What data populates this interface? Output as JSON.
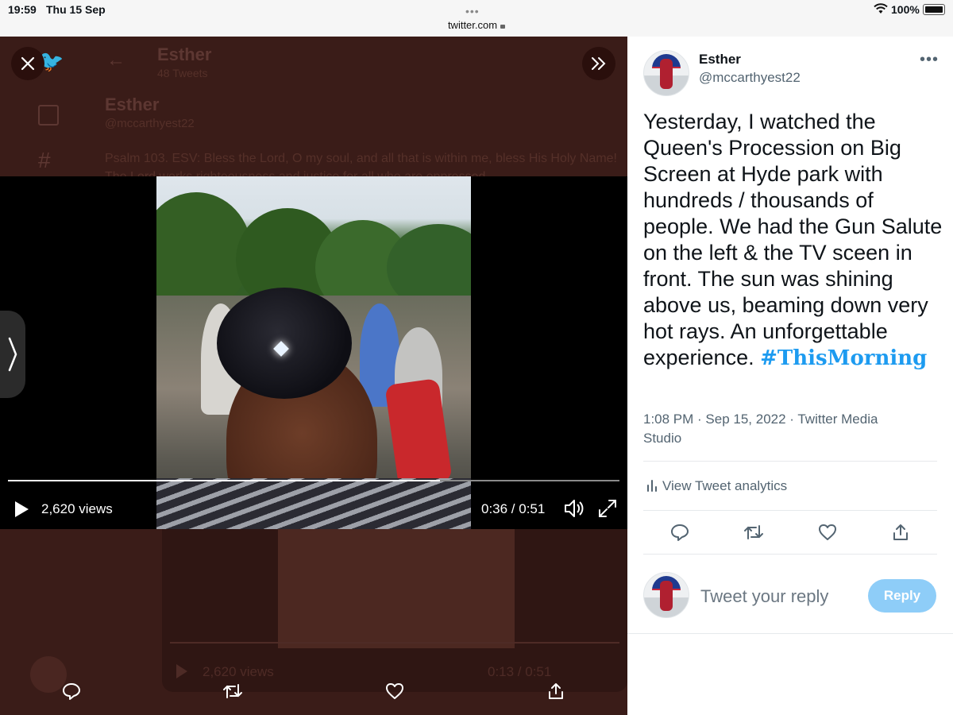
{
  "status_bar": {
    "time": "19:59",
    "date": "Thu 15 Sep",
    "url": "twitter.com",
    "battery": "100%"
  },
  "background": {
    "profile_name": "Esther",
    "tweet_count": "48 Tweets",
    "name": "Esther",
    "handle": "@mccarthyest22",
    "text": "Psalm 103. ESV: Bless the Lord, O my soul, and all that is within me, bless His Holy Name! The Lord works righteousness and justice for all who are oppressed"
  },
  "video": {
    "views": "2,620 views",
    "time": "0:36 / 0:51",
    "progress_fraction": 0.706
  },
  "ghost_video": {
    "views": "2,620 views",
    "time": "0:13 / 0:51"
  },
  "tweet": {
    "name": "Esther",
    "handle": "@mccarthyest22",
    "text": "Yesterday, I watched the Queen's Procession on Big Screen at Hyde park with hundreds / thousands of people. We had the Gun Salute on the left & the TV sceen in front. The sun was shining above us, beaming down very hot rays. An unforgettable experience.",
    "hashtag": "#ThisMorning",
    "meta": "1:08 PM · Sep 15, 2022 · Twitter Media Studio",
    "analytics_label": "View Tweet analytics",
    "reply_placeholder": "Tweet your reply",
    "reply_button": "Reply"
  },
  "colors": {
    "accent": "#1d9bf0",
    "reply_button": "#8ecdf8",
    "overlay_bg": "#3a1c18"
  }
}
